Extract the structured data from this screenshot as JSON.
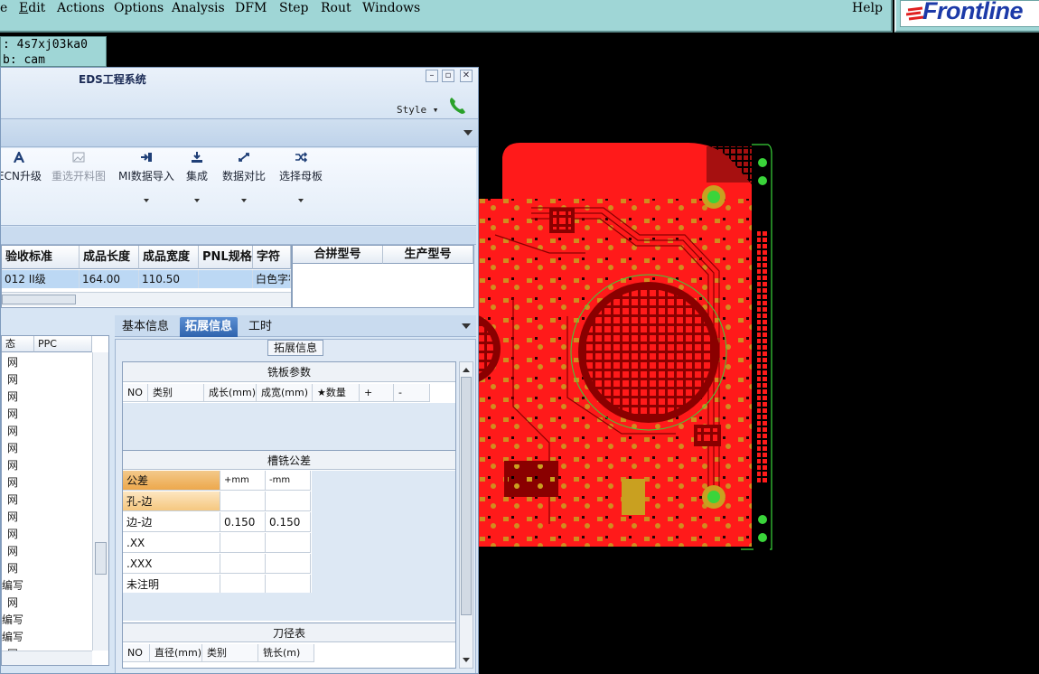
{
  "menubar": {
    "items": [
      "e",
      "Edit",
      "Actions",
      "Options",
      "Analysis",
      "DFM",
      "Step",
      "Rout",
      "Windows"
    ],
    "help": "Help",
    "logo": "Frontline",
    "bg_color": "#9fd6d6"
  },
  "terminal": {
    "line1": ": 4s7xj03ka0",
    "line2": "b: cam"
  },
  "eds": {
    "title": "EDS工程系统",
    "style_label": "Style",
    "ribbon": [
      {
        "label": "ECN升级",
        "icon": "ecn-icon",
        "dim": false,
        "arrow": false
      },
      {
        "label": "重选开料图",
        "icon": "image-icon",
        "dim": true,
        "arrow": false
      },
      {
        "label": "MI数据导入",
        "icon": "import-icon",
        "dim": false,
        "arrow": true
      },
      {
        "label": "集成",
        "icon": "download-icon",
        "dim": false,
        "arrow": true
      },
      {
        "label": "数据对比",
        "icon": "compare-icon",
        "dim": false,
        "arrow": true
      },
      {
        "label": "选择母板",
        "icon": "shuffle-icon",
        "dim": false,
        "arrow": true
      }
    ],
    "grid1": {
      "headers": [
        "验收标准",
        "成品长度",
        "成品宽度",
        "PNL规格",
        "字符"
      ],
      "row": [
        "012 II级",
        "164.00",
        "110.50",
        "",
        "白色字符"
      ]
    },
    "grid2": {
      "headers": [
        "合拼型号",
        "生产型号"
      ]
    },
    "list": {
      "headers": [
        "态",
        "PPC"
      ],
      "rows": [
        "网",
        "网",
        "网",
        "网",
        "网",
        "网",
        "网",
        "网",
        "网",
        "网",
        "网",
        "网",
        "网",
        "编写",
        "网",
        "编写",
        "编写",
        "网"
      ]
    },
    "tabs": [
      "基本信息",
      "拓展信息",
      "工时"
    ],
    "active_tab": "拓展信息",
    "panel_legend": "拓展信息",
    "milling": {
      "title": "铣板参数",
      "columns": [
        "NO",
        "类别",
        "成长(mm)",
        "成宽(mm)",
        "★数量",
        "+",
        "-"
      ]
    },
    "slot": {
      "title": "槽铣公差",
      "columns": [
        "公差",
        "+mm",
        "-mm"
      ],
      "rows": [
        {
          "name": "孔-边",
          "plus": "",
          "minus": ""
        },
        {
          "name": "边-边",
          "plus": "0.150",
          "minus": "0.150"
        },
        {
          "name": ".XX",
          "plus": "",
          "minus": ""
        },
        {
          "name": ".XXX",
          "plus": "",
          "minus": ""
        },
        {
          "name": "未注明",
          "plus": "",
          "minus": ""
        }
      ]
    },
    "tool": {
      "title": "刀径表",
      "columns": [
        "NO",
        "直径(mm)",
        "类别",
        "铣长(m)"
      ]
    }
  },
  "colors": {
    "pcb_copper": "#ff1a1a",
    "pcb_pad": "#c9a020",
    "pcb_outline": "#3ad43a"
  }
}
